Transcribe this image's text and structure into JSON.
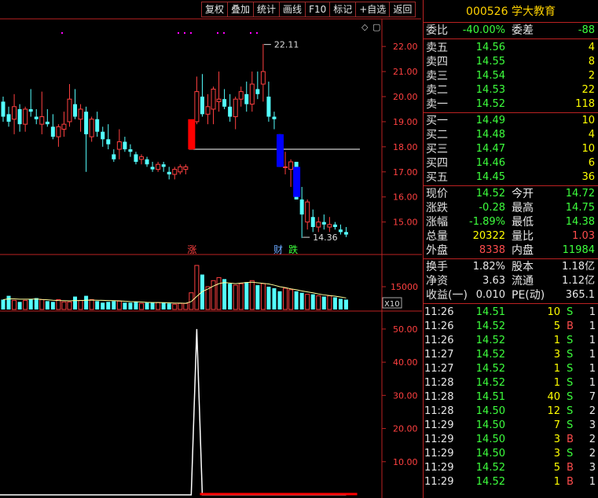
{
  "toolbar": [
    "复权",
    "叠加",
    "统计",
    "画线",
    "F10",
    "标记",
    "+自选",
    "返回"
  ],
  "title": "000526 学大教育",
  "weibi": {
    "label1": "委比",
    "value1": "-40.00%",
    "label2": "委差",
    "value2": "-88"
  },
  "sells": [
    {
      "label": "卖五",
      "price": "14.56",
      "vol": "4"
    },
    {
      "label": "卖四",
      "price": "14.55",
      "vol": "8"
    },
    {
      "label": "卖三",
      "price": "14.54",
      "vol": "2"
    },
    {
      "label": "卖二",
      "price": "14.53",
      "vol": "22"
    },
    {
      "label": "卖一",
      "price": "14.52",
      "vol": "118"
    }
  ],
  "buys": [
    {
      "label": "买一",
      "price": "14.49",
      "vol": "10"
    },
    {
      "label": "买二",
      "price": "14.48",
      "vol": "4"
    },
    {
      "label": "买三",
      "price": "14.47",
      "vol": "10"
    },
    {
      "label": "买四",
      "price": "14.46",
      "vol": "6"
    },
    {
      "label": "买五",
      "price": "14.45",
      "vol": "36"
    }
  ],
  "quote": [
    {
      "l1": "现价",
      "v1": "14.52",
      "c1": "green",
      "l2": "今开",
      "v2": "14.72",
      "c2": "green"
    },
    {
      "l1": "涨跌",
      "v1": "-0.28",
      "c1": "green",
      "l2": "最高",
      "v2": "14.75",
      "c2": "green"
    },
    {
      "l1": "涨幅",
      "v1": "-1.89%",
      "c1": "green",
      "l2": "最低",
      "v2": "14.38",
      "c2": "green"
    },
    {
      "l1": "总量",
      "v1": "20322",
      "c1": "yellow",
      "l2": "量比",
      "v2": "1.03",
      "c2": "red"
    },
    {
      "l1": "外盘",
      "v1": "8338",
      "c1": "red",
      "l2": "内盘",
      "v2": "11984",
      "c2": "green"
    }
  ],
  "fund": [
    {
      "l1": "换手",
      "v1": "1.82%",
      "l2": "股本",
      "v2": "1.18亿"
    },
    {
      "l1": "净资",
      "v1": "3.63",
      "l2": "流通",
      "v2": "1.12亿"
    },
    {
      "l1": "收益(一)",
      "v1": "0.010",
      "l2": "PE(动)",
      "v2": "365.1"
    }
  ],
  "ticks": [
    {
      "t": "11:26",
      "p": "14.51",
      "v": "10",
      "s": "S",
      "n": "1"
    },
    {
      "t": "11:26",
      "p": "14.52",
      "v": "5",
      "s": "B",
      "n": "1"
    },
    {
      "t": "11:26",
      "p": "14.52",
      "v": "1",
      "s": "S",
      "n": "1"
    },
    {
      "t": "11:27",
      "p": "14.52",
      "v": "3",
      "s": "S",
      "n": "1"
    },
    {
      "t": "11:27",
      "p": "14.52",
      "v": "1",
      "s": "S",
      "n": "1"
    },
    {
      "t": "11:28",
      "p": "14.52",
      "v": "1",
      "s": "S",
      "n": "1"
    },
    {
      "t": "11:28",
      "p": "14.51",
      "v": "40",
      "s": "S",
      "n": "7"
    },
    {
      "t": "11:28",
      "p": "14.50",
      "v": "12",
      "s": "S",
      "n": "2"
    },
    {
      "t": "11:29",
      "p": "14.50",
      "v": "7",
      "s": "S",
      "n": "3"
    },
    {
      "t": "11:29",
      "p": "14.50",
      "v": "3",
      "s": "B",
      "n": "2"
    },
    {
      "t": "11:29",
      "p": "14.50",
      "v": "3",
      "s": "S",
      "n": "2"
    },
    {
      "t": "11:29",
      "p": "14.52",
      "v": "5",
      "s": "B",
      "n": "3"
    },
    {
      "t": "11:29",
      "p": "14.52",
      "v": "1",
      "s": "B",
      "n": "1"
    }
  ],
  "chart_data": [
    {
      "type": "candlestick",
      "ylim": [
        14.3,
        22.6
      ],
      "yticks": [
        "22.00",
        "21.00",
        "20.00",
        "19.00",
        "18.00",
        "17.00",
        "16.00",
        "15.00"
      ],
      "ohlc": [
        [
          19.8,
          20.0,
          19.0,
          19.2
        ],
        [
          19.3,
          19.6,
          18.8,
          19.0
        ],
        [
          19.1,
          20.1,
          18.5,
          19.6
        ],
        [
          19.5,
          19.7,
          18.6,
          18.9
        ],
        [
          18.9,
          19.6,
          18.6,
          19.5
        ],
        [
          19.5,
          20.3,
          19.2,
          19.4
        ],
        [
          19.2,
          19.5,
          18.9,
          19.1
        ],
        [
          18.9,
          20.2,
          18.5,
          19.2
        ],
        [
          19.0,
          19.5,
          18.8,
          18.9
        ],
        [
          18.8,
          19.3,
          18.3,
          18.4
        ],
        [
          18.4,
          18.9,
          18.0,
          18.8
        ],
        [
          18.7,
          19.4,
          18.4,
          18.9
        ],
        [
          19.0,
          20.5,
          18.8,
          19.9
        ],
        [
          19.7,
          20.3,
          19.1,
          19.2
        ],
        [
          19.1,
          19.7,
          18.6,
          19.5
        ],
        [
          19.4,
          19.6,
          17.0,
          18.5
        ],
        [
          18.4,
          19.2,
          18.2,
          19.1
        ],
        [
          19.1,
          19.4,
          18.4,
          18.6
        ],
        [
          18.6,
          18.8,
          18.0,
          18.3
        ],
        [
          18.3,
          18.9,
          17.9,
          18.1
        ],
        [
          17.7,
          17.9,
          17.4,
          17.5
        ],
        [
          17.9,
          18.7,
          17.5,
          18.2
        ],
        [
          18.2,
          18.4,
          17.8,
          17.9
        ],
        [
          17.9,
          18.1,
          17.6,
          17.8
        ],
        [
          17.7,
          17.8,
          17.3,
          17.4
        ],
        [
          17.5,
          17.7,
          17.3,
          17.6
        ],
        [
          17.5,
          17.6,
          17.2,
          17.3
        ],
        [
          17.2,
          17.4,
          17.0,
          17.1
        ],
        [
          17.1,
          17.4,
          17.0,
          17.3
        ],
        [
          17.3,
          17.4,
          17.0,
          17.2
        ],
        [
          17.0,
          17.2,
          16.7,
          16.9
        ],
        [
          16.9,
          17.2,
          16.7,
          17.1
        ],
        [
          17.0,
          17.3,
          16.9,
          17.2
        ],
        [
          17.1,
          17.3,
          16.9,
          17.2
        ],
        [
          17.9,
          19.0,
          17.9,
          19.0
        ],
        [
          19.0,
          20.8,
          18.9,
          20.2
        ],
        [
          20.0,
          20.9,
          19.2,
          19.3
        ],
        [
          19.3,
          20.1,
          18.9,
          19.6
        ],
        [
          19.5,
          20.4,
          18.9,
          20.3
        ],
        [
          19.8,
          21.0,
          19.4,
          19.9
        ],
        [
          19.9,
          20.3,
          19.5,
          19.6
        ],
        [
          19.6,
          20.1,
          19.0,
          19.2
        ],
        [
          19.2,
          20.0,
          18.7,
          19.9
        ],
        [
          19.9,
          20.4,
          19.6,
          20.2
        ],
        [
          20.1,
          20.6,
          19.4,
          19.7
        ],
        [
          19.7,
          21.0,
          19.4,
          20.5
        ],
        [
          20.3,
          21.0,
          19.9,
          20.1
        ],
        [
          20.5,
          22.1,
          19.8,
          21.0
        ],
        [
          20.0,
          20.6,
          19.0,
          19.2
        ],
        [
          19.2,
          19.4,
          18.7,
          19.1
        ],
        [
          18.5,
          18.5,
          17.2,
          17.2
        ],
        [
          17.2,
          17.8,
          16.9,
          17.2
        ],
        [
          17.1,
          17.5,
          16.4,
          17.4
        ],
        [
          17.4,
          17.4,
          15.9,
          15.9
        ],
        [
          15.9,
          16.4,
          14.36,
          15.3
        ],
        [
          15.0,
          15.9,
          14.7,
          15.8
        ],
        [
          15.2,
          15.5,
          14.6,
          14.8
        ],
        [
          14.8,
          15.2,
          14.6,
          15.0
        ],
        [
          15.0,
          15.3,
          14.7,
          14.9
        ],
        [
          14.8,
          15.2,
          14.6,
          14.9
        ],
        [
          14.9,
          15.0,
          14.7,
          14.8
        ],
        [
          14.7,
          14.9,
          14.5,
          14.6
        ],
        [
          14.6,
          14.8,
          14.4,
          14.5
        ]
      ],
      "hline": 17.9,
      "annotations": [
        {
          "text": "22.11",
          "value": 22.11
        },
        {
          "text": "14.36",
          "value": 14.36
        },
        {
          "text": "涨",
          "color": "#ff4040"
        },
        {
          "text": "财",
          "color": "#6aa8ff"
        },
        {
          "text": "跌",
          "color": "#3dff3d"
        }
      ],
      "blocks": [
        {
          "i": 34,
          "o": 17.9,
          "c": 19.1,
          "color": "#ff0000"
        },
        {
          "i": 50,
          "o": 18.5,
          "c": 17.2,
          "color": "#0000ff"
        },
        {
          "i": 53,
          "o": 17.2,
          "c": 16.0,
          "color": "#0000ff"
        }
      ]
    },
    {
      "type": "bar",
      "ylabel": "15000",
      "unit": "X10",
      "ylim": [
        0,
        30000
      ],
      "values": [
        6500,
        9000,
        6000,
        5000,
        6000,
        7000,
        7500,
        6500,
        5500,
        5000,
        6500,
        5000,
        5000,
        8500,
        6000,
        9000,
        6500,
        5500,
        4500,
        5000,
        5500,
        5500,
        4500,
        4500,
        5000,
        4000,
        4500,
        4500,
        4500,
        4500,
        4000,
        3500,
        4000,
        4000,
        11000,
        29000,
        23000,
        15000,
        19000,
        21000,
        20000,
        17000,
        16000,
        17000,
        18000,
        19000,
        16000,
        17000,
        15000,
        14000,
        12000,
        14000,
        13000,
        12000,
        11000,
        10000,
        10000,
        9000,
        8500,
        9000,
        8000,
        7000,
        6500
      ],
      "ma": [
        6500,
        7000,
        7000,
        6800,
        6800,
        6800,
        6900,
        6600,
        6400,
        6100,
        5900,
        5800,
        5700,
        5900,
        5900,
        6100,
        6200,
        6100,
        6000,
        5900,
        5800,
        5700,
        5400,
        5200,
        5100,
        4900,
        4700,
        4600,
        4600,
        4500,
        4400,
        4200,
        4200,
        4100,
        5200,
        8600,
        11800,
        13500,
        15400,
        17000,
        17800,
        17400,
        17000,
        17400,
        17800,
        18000,
        17600,
        17200,
        16800,
        16000,
        15000,
        14400,
        13600,
        13000,
        12200,
        11600,
        11000,
        10200,
        9600,
        9200,
        8800,
        8200,
        7600
      ]
    },
    {
      "type": "line",
      "yticks": [
        "50.00",
        "40.00",
        "30.00",
        "20.00",
        "10.00"
      ],
      "ylim": [
        0,
        54
      ],
      "values": [
        0,
        0,
        0,
        0,
        0,
        0,
        0,
        0,
        0,
        0,
        0,
        0,
        0,
        0,
        0,
        0,
        0,
        0,
        0,
        0,
        0,
        0,
        0,
        0,
        0,
        0,
        0,
        0,
        0,
        0,
        0,
        0,
        0,
        0,
        0,
        50,
        0,
        0,
        0,
        0,
        0,
        0,
        0,
        0,
        0,
        0,
        0,
        0,
        0,
        0,
        0,
        0,
        0,
        0,
        0,
        0,
        0,
        0,
        0,
        0,
        0,
        0,
        0
      ]
    }
  ]
}
